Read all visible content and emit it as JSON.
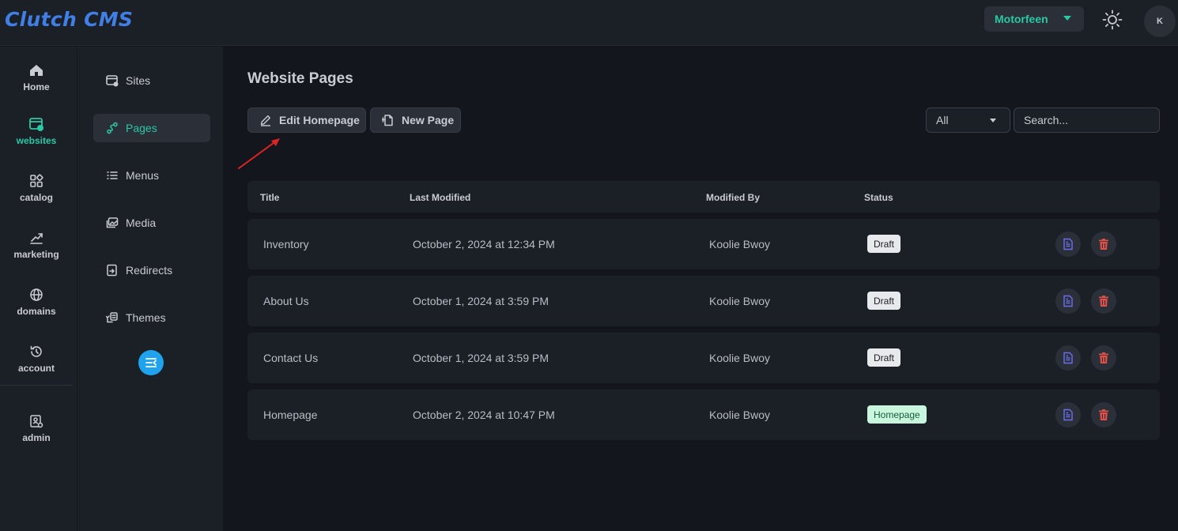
{
  "app": {
    "title": "Clutch CMS"
  },
  "header": {
    "site": "Motorfeen",
    "avatar_initial": "K"
  },
  "rail": [
    {
      "label": "Home",
      "icon": "home-icon"
    },
    {
      "label": "websites",
      "icon": "websites-icon",
      "active": true
    },
    {
      "label": "catalog",
      "icon": "catalog-icon"
    },
    {
      "label": "marketing",
      "icon": "marketing-icon"
    },
    {
      "label": "domains",
      "icon": "globe-icon"
    },
    {
      "label": "account",
      "icon": "history-icon"
    },
    {
      "label": "admin",
      "icon": "admin-icon"
    }
  ],
  "subnav": [
    {
      "label": "Sites",
      "icon": "sites-icon"
    },
    {
      "label": "Pages",
      "icon": "pages-icon",
      "active": true
    },
    {
      "label": "Menus",
      "icon": "menus-icon"
    },
    {
      "label": "Media",
      "icon": "media-icon"
    },
    {
      "label": "Redirects",
      "icon": "redirects-icon"
    },
    {
      "label": "Themes",
      "icon": "themes-icon"
    }
  ],
  "main": {
    "title": "Website Pages",
    "edit_homepage": "Edit Homepage",
    "new_page": "New Page",
    "filter_value": "All",
    "search_placeholder": "Search..."
  },
  "table": {
    "columns": [
      "Title",
      "Last Modified",
      "Modified By",
      "Status"
    ],
    "rows": [
      {
        "title": "Inventory",
        "modified": "October 2, 2024 at 12:34 PM",
        "by": "Koolie Bwoy",
        "status": "Draft"
      },
      {
        "title": "About Us",
        "modified": "October 1, 2024 at 3:59 PM",
        "by": "Koolie Bwoy",
        "status": "Draft"
      },
      {
        "title": "Contact Us",
        "modified": "October 1, 2024 at 3:59 PM",
        "by": "Koolie Bwoy",
        "status": "Draft"
      },
      {
        "title": "Homepage",
        "modified": "October 2, 2024 at 10:47 PM",
        "by": "Koolie Bwoy",
        "status": "Homepage"
      }
    ]
  },
  "colors": {
    "accent": "#2bc8a6",
    "brand": "#3f7fe6",
    "delete": "#e0504a",
    "doc": "#6b6ff0"
  }
}
